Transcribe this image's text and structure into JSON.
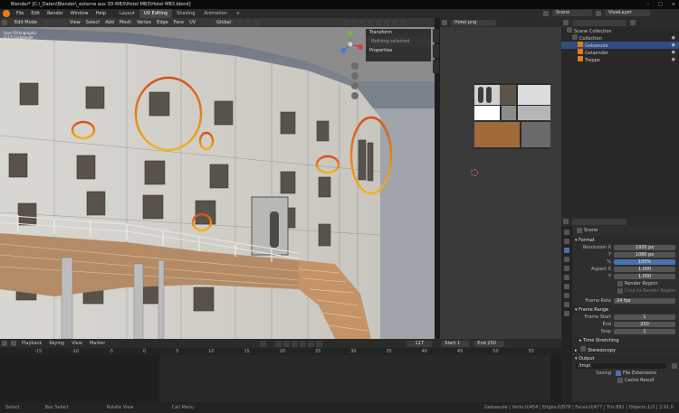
{
  "app": {
    "title": "Blender* [C:\\_Daten\\Blender\\_externe aus 3D-MB3\\Hotel MB3\\Hotel MB3.blend]",
    "window_controls": [
      "–",
      "□",
      "×"
    ]
  },
  "menus": [
    "File",
    "Edit",
    "Render",
    "Window",
    "Help"
  ],
  "workspaces": [
    "Layout",
    "UV Editing",
    "Shading",
    "Animation"
  ],
  "active_workspace": "UV Editing",
  "scene": "Scene",
  "view_layer": "ViewLayer",
  "viewport": {
    "mode": "Edit Mode",
    "menu": [
      "View",
      "Select",
      "Add",
      "Mesh",
      "Vertex",
      "Edge",
      "Face",
      "UV"
    ],
    "orientation": "Global",
    "view_label": "User Orthographic",
    "object_label": "(117) Gebaeude",
    "npanel": {
      "transform_header": "Transform",
      "nothing_selected": "Nothing selected",
      "properties_header": "Properties"
    },
    "side_tabs": [
      "Item",
      "Tool",
      "View"
    ]
  },
  "uv_editor": {
    "image_name": "Hotel.png"
  },
  "outliner": {
    "search_placeholder": "",
    "items": [
      {
        "label": "Scene Collection",
        "indent": 0
      },
      {
        "label": "Collection",
        "indent": 1
      },
      {
        "label": "Gebaeude",
        "indent": 2,
        "selected": true
      },
      {
        "label": "Gelaender",
        "indent": 2
      },
      {
        "label": "Treppe",
        "indent": 2
      }
    ]
  },
  "properties": {
    "scene_label": "Scene",
    "format": {
      "header": "Format",
      "resolution_x_label": "Resolution X",
      "resolution_x": "1920 px",
      "y_label": "Y",
      "resolution_y": "1080 px",
      "percent_label": "%",
      "percent": "100%",
      "aspect_x_label": "Aspect X",
      "aspect_x": "1.000",
      "aspect_y": "1.000",
      "render_region": "Render Region",
      "crop": "Crop to Render Region",
      "frame_rate_label": "Frame Rate",
      "frame_rate": "24 fps"
    },
    "frame_range": {
      "header": "Frame Range",
      "start_label": "Frame Start",
      "start": "1",
      "end_label": "End",
      "end": "250",
      "step_label": "Step",
      "step": "1"
    },
    "time_stretching": "Time Stretching",
    "stereoscopy": "Stereoscopy",
    "output": {
      "header": "Output",
      "path": "/tmp\\",
      "saving_label": "Saving",
      "file_extensions": "File Extensions",
      "cache_result": "Cache Result"
    }
  },
  "timeline": {
    "menu": [
      "Playback",
      "Keying",
      "View",
      "Marker"
    ],
    "current_frame": "117",
    "start_label": "Start",
    "start": "1",
    "end_label": "End",
    "end": "250",
    "ruler": [
      "-15",
      "-10",
      "-5",
      "0",
      "5",
      "10",
      "15",
      "20",
      "25",
      "30",
      "35",
      "40",
      "45",
      "50",
      "55"
    ]
  },
  "status": {
    "left": [
      "Select",
      "Box Select",
      "Rotate View",
      "Call Menu"
    ],
    "right": "Gebaeude | Verts:0/454 | Edges:0/878 | Faces:0/477 | Tris:891 | Objects:1/3 | 2.91.0"
  },
  "colors": {
    "accent_blue": "#4772b3",
    "highlight_orange": "#e87d0d",
    "selection_blue": "#334d80"
  }
}
